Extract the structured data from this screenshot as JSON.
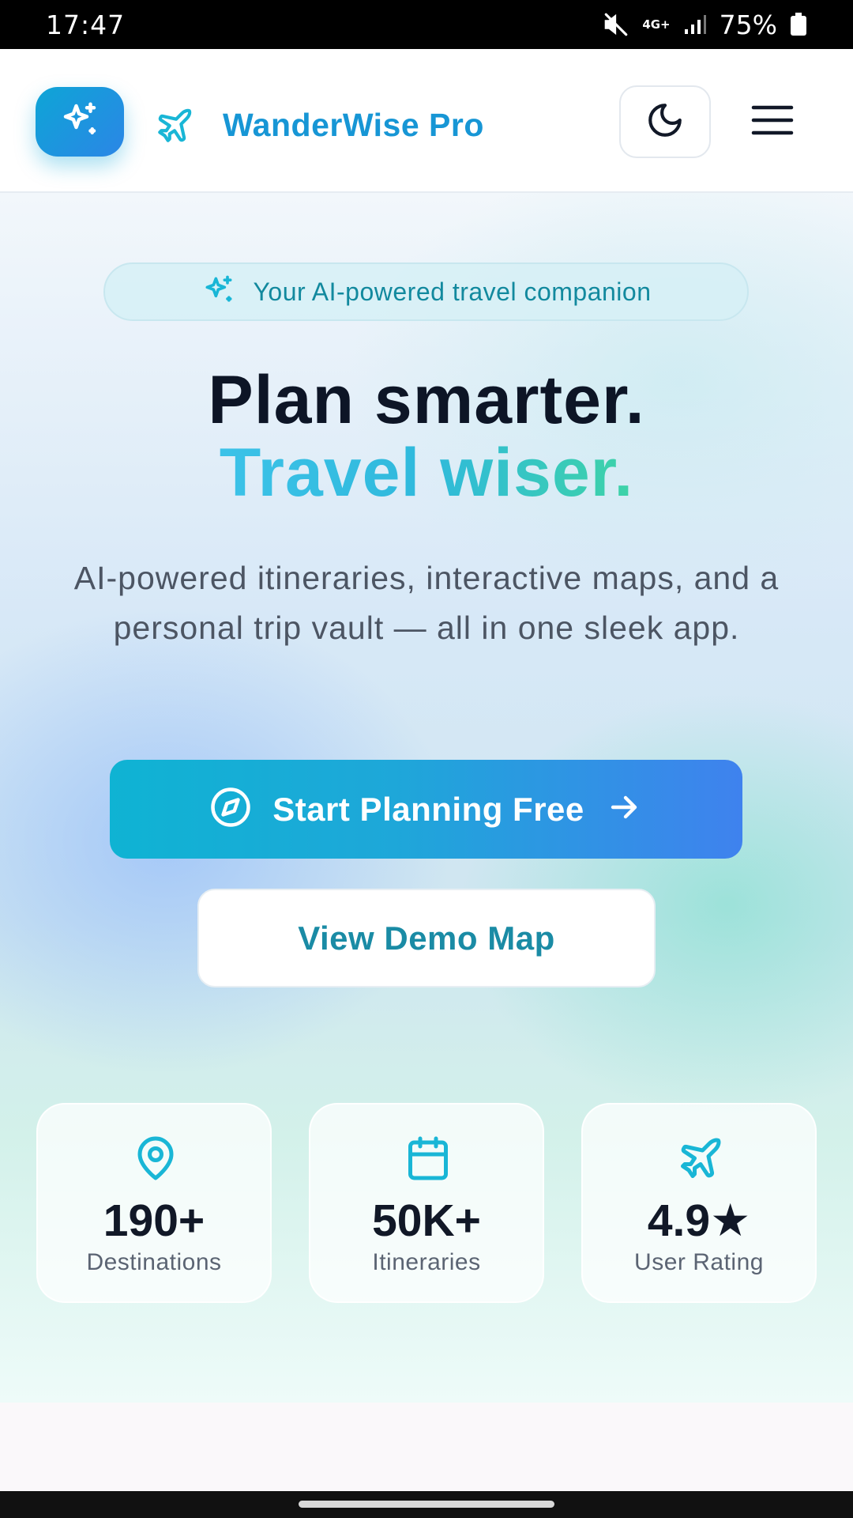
{
  "status_bar": {
    "time": "17:47",
    "network": "4G+",
    "battery": "75%"
  },
  "header": {
    "brand_name": "WanderWise Pro",
    "ai_button_icon": "sparkles-icon",
    "brand_icon": "plane-icon",
    "theme_icon": "moon-icon",
    "menu_icon": "hamburger-menu-icon"
  },
  "hero": {
    "badge_text": "Your AI-powered travel companion",
    "headline_line1": "Plan smarter.",
    "headline_line2": "Travel wiser.",
    "subtext": "AI-powered itineraries, interactive maps, and a personal trip vault — all in one sleek app.",
    "primary_cta": "Start Planning Free",
    "secondary_cta": "View Demo Map"
  },
  "stats": [
    {
      "value": "190+",
      "label": "Destinations",
      "icon": "map-pin-icon"
    },
    {
      "value": "50K+",
      "label": "Itineraries",
      "icon": "calendar-icon"
    },
    {
      "value": "4.9★",
      "label": "User Rating",
      "icon": "plane-icon"
    }
  ],
  "colors": {
    "brand": "#1796d5",
    "accent_teal": "#12899e",
    "cta_gradient_start": "#0fb3d3",
    "cta_gradient_end": "#3f82ee",
    "headline_dark": "#0d1526"
  }
}
